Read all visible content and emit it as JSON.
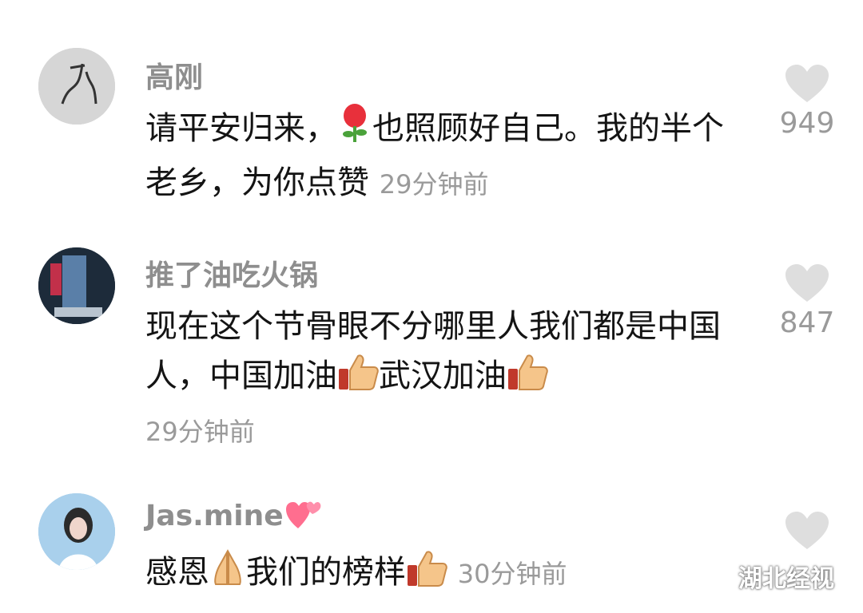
{
  "comments": [
    {
      "name": "高刚",
      "text_part1": "请平安归来，",
      "text_part2": "也照顾好自己。我的半个老乡，为你点赞",
      "time": "29分钟前",
      "likes": "949",
      "emoji": [
        "rose-icon"
      ]
    },
    {
      "name": "推了油吃火锅",
      "text_part1": "现在这个节骨眼不分哪里人我们都是中国人，中国加油",
      "text_part2": "武汉加油",
      "time": "29分钟前",
      "likes": "847",
      "emoji": [
        "thumbs-up-icon",
        "thumbs-up-icon"
      ]
    },
    {
      "name": "Jas.mine",
      "text_part1": "感恩",
      "text_part2": "我们的榜样",
      "time": "30分钟前",
      "likes": "",
      "emoji": [
        "two-hearts-icon",
        "praying-hands-icon",
        "thumbs-up-icon"
      ]
    }
  ],
  "watermark": "湖北经视",
  "colors": {
    "name": "#8e8e8e",
    "text": "#141414",
    "meta": "#9a9a9a",
    "heart": "#dedede"
  }
}
